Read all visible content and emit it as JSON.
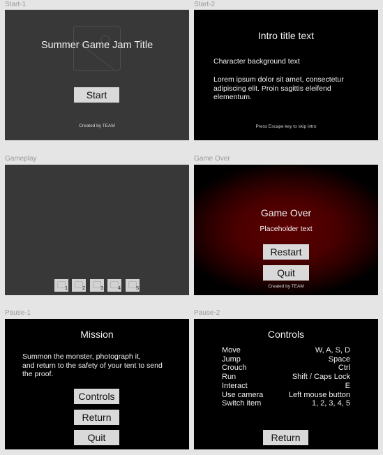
{
  "frames": {
    "start1": {
      "label": "Start-1",
      "title": "Summer Game Jam Title",
      "start_label": "Start",
      "credit": "Created by TEAM",
      "image_icon": "image-placeholder-icon"
    },
    "start2": {
      "label": "Start-2",
      "title": "Intro title text",
      "subtitle": "Character background text",
      "body": "Lorem ipsum dolor sit amet, consectetur adipiscing elit. Proin sagittis eleifend elementum.",
      "hint": "Press Escape key to skip intro"
    },
    "gameplay": {
      "label": "Gameplay",
      "slots": [
        "1",
        "2",
        "3",
        "4",
        "5"
      ],
      "slot_icon": "item-slot-icon"
    },
    "gameover": {
      "label": "Game Over",
      "title": "Game Over",
      "subtitle": "Placeholder text",
      "restart_label": "Restart",
      "quit_label": "Quit",
      "credit": "Created by TEAM",
      "accent_color": "#5c0000"
    },
    "pause1": {
      "label": "Pause-1",
      "title": "Mission",
      "body_lines": [
        "Summon the monster, photograph it,",
        "and return to the safety of your tent to send",
        "the proof."
      ],
      "controls_label": "Controls",
      "return_label": "Return",
      "quit_label": "Quit"
    },
    "pause2": {
      "label": "Pause-2",
      "title": "Controls",
      "controls": [
        {
          "action": "Move",
          "key": "W, A, S, D"
        },
        {
          "action": "Jump",
          "key": "Space"
        },
        {
          "action": "Crouch",
          "key": "Ctrl"
        },
        {
          "action": "Run",
          "key": "Shift / Caps Lock"
        },
        {
          "action": "Interact",
          "key": "E"
        },
        {
          "action": "Use camera",
          "key": "Left mouse button"
        },
        {
          "action": "Switch item",
          "key": "1, 2, 3, 4, 5"
        }
      ],
      "return_label": "Return"
    }
  }
}
